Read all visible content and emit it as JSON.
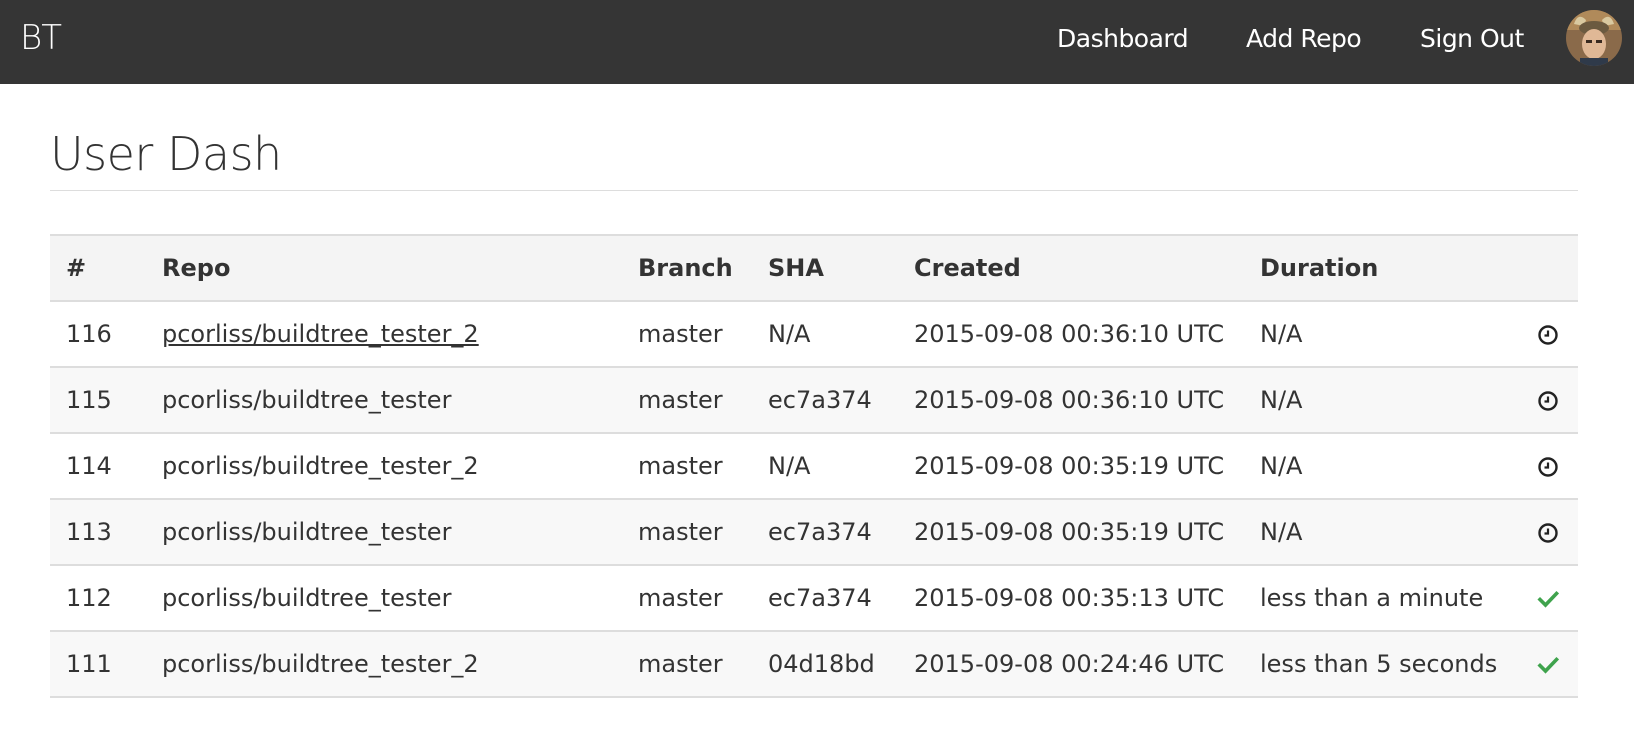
{
  "navbar": {
    "brand": "BT",
    "links": [
      {
        "label": "Dashboard"
      },
      {
        "label": "Add Repo"
      },
      {
        "label": "Sign Out"
      }
    ],
    "avatar_icon": "user-avatar"
  },
  "page": {
    "title": "User Dash"
  },
  "table": {
    "headers": [
      "#",
      "Repo",
      "Branch",
      "SHA",
      "Created",
      "Duration"
    ],
    "rows": [
      {
        "num": "116",
        "repo": "pcorliss/buildtree_tester_2",
        "branch": "master",
        "sha": "N/A",
        "created": "2015-09-08 00:36:10 UTC",
        "duration": "N/A",
        "status": "pending"
      },
      {
        "num": "115",
        "repo": "pcorliss/buildtree_tester",
        "branch": "master",
        "sha": "ec7a374",
        "created": "2015-09-08 00:36:10 UTC",
        "duration": "N/A",
        "status": "pending"
      },
      {
        "num": "114",
        "repo": "pcorliss/buildtree_tester_2",
        "branch": "master",
        "sha": "N/A",
        "created": "2015-09-08 00:35:19 UTC",
        "duration": "N/A",
        "status": "pending"
      },
      {
        "num": "113",
        "repo": "pcorliss/buildtree_tester",
        "branch": "master",
        "sha": "ec7a374",
        "created": "2015-09-08 00:35:19 UTC",
        "duration": "N/A",
        "status": "pending"
      },
      {
        "num": "112",
        "repo": "pcorliss/buildtree_tester",
        "branch": "master",
        "sha": "ec7a374",
        "created": "2015-09-08 00:35:13 UTC",
        "duration": "less than a minute",
        "status": "success"
      },
      {
        "num": "111",
        "repo": "pcorliss/buildtree_tester_2",
        "branch": "master",
        "sha": "04d18bd",
        "created": "2015-09-08 00:24:46 UTC",
        "duration": "less than 5 seconds",
        "status": "success"
      }
    ]
  },
  "colors": {
    "navbar_bg": "#353535",
    "success": "#3fa34d",
    "text": "#333333"
  }
}
